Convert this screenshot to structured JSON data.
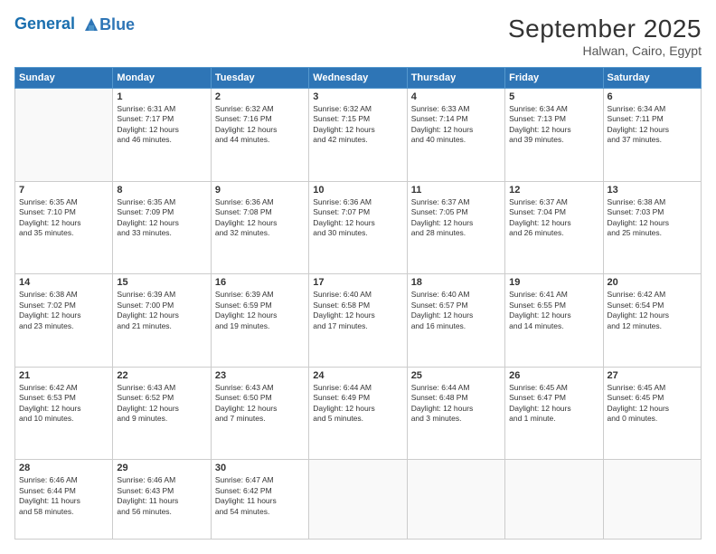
{
  "header": {
    "logo_line1": "General",
    "logo_line2": "Blue",
    "month_title": "September 2025",
    "location": "Halwan, Cairo, Egypt"
  },
  "columns": [
    "Sunday",
    "Monday",
    "Tuesday",
    "Wednesday",
    "Thursday",
    "Friday",
    "Saturday"
  ],
  "weeks": [
    [
      {
        "day": "",
        "info": ""
      },
      {
        "day": "1",
        "info": "Sunrise: 6:31 AM\nSunset: 7:17 PM\nDaylight: 12 hours\nand 46 minutes."
      },
      {
        "day": "2",
        "info": "Sunrise: 6:32 AM\nSunset: 7:16 PM\nDaylight: 12 hours\nand 44 minutes."
      },
      {
        "day": "3",
        "info": "Sunrise: 6:32 AM\nSunset: 7:15 PM\nDaylight: 12 hours\nand 42 minutes."
      },
      {
        "day": "4",
        "info": "Sunrise: 6:33 AM\nSunset: 7:14 PM\nDaylight: 12 hours\nand 40 minutes."
      },
      {
        "day": "5",
        "info": "Sunrise: 6:34 AM\nSunset: 7:13 PM\nDaylight: 12 hours\nand 39 minutes."
      },
      {
        "day": "6",
        "info": "Sunrise: 6:34 AM\nSunset: 7:11 PM\nDaylight: 12 hours\nand 37 minutes."
      }
    ],
    [
      {
        "day": "7",
        "info": "Sunrise: 6:35 AM\nSunset: 7:10 PM\nDaylight: 12 hours\nand 35 minutes."
      },
      {
        "day": "8",
        "info": "Sunrise: 6:35 AM\nSunset: 7:09 PM\nDaylight: 12 hours\nand 33 minutes."
      },
      {
        "day": "9",
        "info": "Sunrise: 6:36 AM\nSunset: 7:08 PM\nDaylight: 12 hours\nand 32 minutes."
      },
      {
        "day": "10",
        "info": "Sunrise: 6:36 AM\nSunset: 7:07 PM\nDaylight: 12 hours\nand 30 minutes."
      },
      {
        "day": "11",
        "info": "Sunrise: 6:37 AM\nSunset: 7:05 PM\nDaylight: 12 hours\nand 28 minutes."
      },
      {
        "day": "12",
        "info": "Sunrise: 6:37 AM\nSunset: 7:04 PM\nDaylight: 12 hours\nand 26 minutes."
      },
      {
        "day": "13",
        "info": "Sunrise: 6:38 AM\nSunset: 7:03 PM\nDaylight: 12 hours\nand 25 minutes."
      }
    ],
    [
      {
        "day": "14",
        "info": "Sunrise: 6:38 AM\nSunset: 7:02 PM\nDaylight: 12 hours\nand 23 minutes."
      },
      {
        "day": "15",
        "info": "Sunrise: 6:39 AM\nSunset: 7:00 PM\nDaylight: 12 hours\nand 21 minutes."
      },
      {
        "day": "16",
        "info": "Sunrise: 6:39 AM\nSunset: 6:59 PM\nDaylight: 12 hours\nand 19 minutes."
      },
      {
        "day": "17",
        "info": "Sunrise: 6:40 AM\nSunset: 6:58 PM\nDaylight: 12 hours\nand 17 minutes."
      },
      {
        "day": "18",
        "info": "Sunrise: 6:40 AM\nSunset: 6:57 PM\nDaylight: 12 hours\nand 16 minutes."
      },
      {
        "day": "19",
        "info": "Sunrise: 6:41 AM\nSunset: 6:55 PM\nDaylight: 12 hours\nand 14 minutes."
      },
      {
        "day": "20",
        "info": "Sunrise: 6:42 AM\nSunset: 6:54 PM\nDaylight: 12 hours\nand 12 minutes."
      }
    ],
    [
      {
        "day": "21",
        "info": "Sunrise: 6:42 AM\nSunset: 6:53 PM\nDaylight: 12 hours\nand 10 minutes."
      },
      {
        "day": "22",
        "info": "Sunrise: 6:43 AM\nSunset: 6:52 PM\nDaylight: 12 hours\nand 9 minutes."
      },
      {
        "day": "23",
        "info": "Sunrise: 6:43 AM\nSunset: 6:50 PM\nDaylight: 12 hours\nand 7 minutes."
      },
      {
        "day": "24",
        "info": "Sunrise: 6:44 AM\nSunset: 6:49 PM\nDaylight: 12 hours\nand 5 minutes."
      },
      {
        "day": "25",
        "info": "Sunrise: 6:44 AM\nSunset: 6:48 PM\nDaylight: 12 hours\nand 3 minutes."
      },
      {
        "day": "26",
        "info": "Sunrise: 6:45 AM\nSunset: 6:47 PM\nDaylight: 12 hours\nand 1 minute."
      },
      {
        "day": "27",
        "info": "Sunrise: 6:45 AM\nSunset: 6:45 PM\nDaylight: 12 hours\nand 0 minutes."
      }
    ],
    [
      {
        "day": "28",
        "info": "Sunrise: 6:46 AM\nSunset: 6:44 PM\nDaylight: 11 hours\nand 58 minutes."
      },
      {
        "day": "29",
        "info": "Sunrise: 6:46 AM\nSunset: 6:43 PM\nDaylight: 11 hours\nand 56 minutes."
      },
      {
        "day": "30",
        "info": "Sunrise: 6:47 AM\nSunset: 6:42 PM\nDaylight: 11 hours\nand 54 minutes."
      },
      {
        "day": "",
        "info": ""
      },
      {
        "day": "",
        "info": ""
      },
      {
        "day": "",
        "info": ""
      },
      {
        "day": "",
        "info": ""
      }
    ]
  ]
}
